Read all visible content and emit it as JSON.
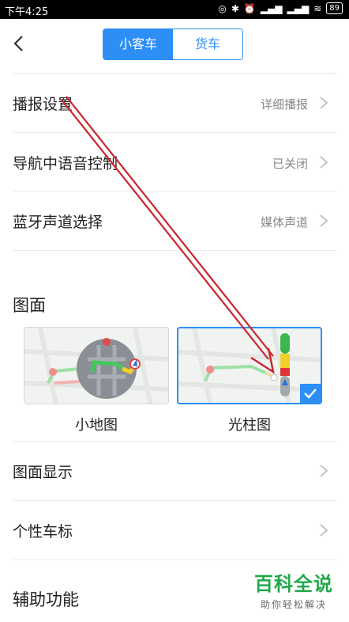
{
  "status_bar": {
    "time": "下午4:25",
    "battery": "89"
  },
  "nav": {
    "tabs": [
      {
        "label": "小客车",
        "active": true
      },
      {
        "label": "货车",
        "active": false
      }
    ]
  },
  "settings_rows": [
    {
      "label": "播报设置",
      "value": "详细播报"
    },
    {
      "label": "导航中语音控制",
      "value": "已关闭"
    },
    {
      "label": "蓝牙声道选择",
      "value": "媒体声道"
    }
  ],
  "map_section": {
    "title": "图面",
    "options": [
      {
        "label": "小地图",
        "selected": false
      },
      {
        "label": "光柱图",
        "selected": true
      }
    ]
  },
  "map_rows": [
    {
      "label": "图面显示"
    },
    {
      "label": "个性车标"
    }
  ],
  "assist_section": {
    "title": "辅助功能"
  },
  "watermark": {
    "brand": "百科全说",
    "slogan": "助你轻松解决"
  },
  "colors": {
    "accent": "#2d8ef5",
    "annotation": "#c9252b",
    "watermark": "#22a84a"
  }
}
